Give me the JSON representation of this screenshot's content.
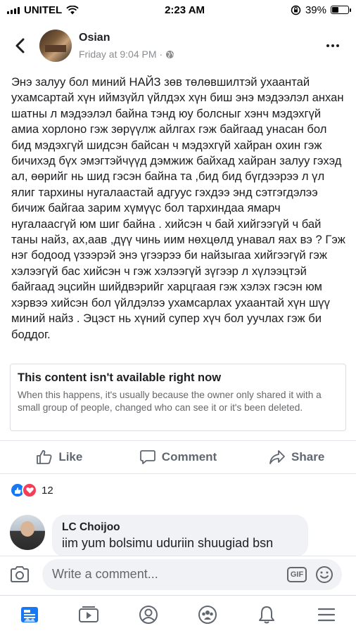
{
  "status_bar": {
    "carrier": "UNITEL",
    "time": "2:23 AM",
    "battery_percent": "39%",
    "battery_level": 0.39
  },
  "post": {
    "author": "Osian",
    "timestamp": "Friday at 9:04 PM",
    "privacy_icon": "globe-icon",
    "text": "Энэ залуу бол миний НАЙЗ зөв төлөвшилтэй ухаантай ухамсартай хүн иймзүйл үйлдэх хүн биш энэ мэдээлэл анхан шатны л мэдээлэл байна тэнд юу болсныг хэнч мэдэхгүй амиа хорлоно гэж зөрүүлж айлгах гэж байгаад унасан бол бид мэдэхгүй шидсэн байсан ч мэдэхгүй хайран охин гэж бичихэд бүх эмэгтэйчүүд дэмжиж байхад хайран залуу гэхэд ал, өөрийг нь шид гэсэн байна та ,бид бид бүгдээрээ л үл ялиг тархины нугалаастай адгуус гэхдээ энд сэтгэгдэлээ бичиж байгаа зарим хүмүүс бол тархиндаа ямарч нугалаасгүй юм шиг байна . хийсэн ч бай хийгээгүй ч бай таны найз, ах,аав ,дүү чинь иим нөхцөлд унавал яах вэ ? Гэж нэг бодоод үзээрэй энэ үгээрээ би найзыгаа хийгээгүй гэж хэлээгүй бас хийсэн ч гэж хэлээгүй зүгээр л хүлээцтэй байгаад эцсийн шийдвэрийг харцгаая гэж хэлэх гэсэн юм хэрвээ хийсэн бол үйлдэлээ ухамсарлах ухаантай хүн шүү миний найз . Эцэст нь хүний супер хүч бол уучлах гэж би боддог."
  },
  "unavailable": {
    "title": "This content isn't available right now",
    "description": "When this happens, it's usually because the owner only shared it with a small group of people, changed who can see it or it's been deleted."
  },
  "actions": {
    "like": "Like",
    "comment": "Comment",
    "share": "Share"
  },
  "reactions": {
    "count": "12",
    "types": [
      "like",
      "love"
    ]
  },
  "comment": {
    "author": "LC Choijoo",
    "text": "iim yum bolsimu uduriin shuugiad bsn"
  },
  "composer": {
    "placeholder": "Write a comment...",
    "gif_label": "GIF"
  },
  "tabs": [
    "news-feed",
    "watch",
    "profile",
    "groups",
    "notifications",
    "menu"
  ],
  "colors": {
    "accent": "#1877f2",
    "love": "#f33e58",
    "text_secondary": "#65676b"
  }
}
